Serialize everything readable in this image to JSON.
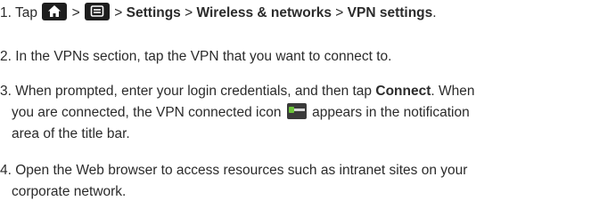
{
  "steps": [
    {
      "number": "1.",
      "prefix": "Tap",
      "sep1": ">",
      "sep2": ">",
      "settings": "Settings",
      "sep3": ">",
      "wireless": "Wireless & networks",
      "sep4": ">",
      "vpn_settings": "VPN settings",
      "end": ".",
      "icons": [
        "home-icon",
        "menu-icon"
      ]
    },
    {
      "number": "2.",
      "text": "In the VPNs section, tap the VPN that you want to connect to."
    },
    {
      "number": "3.",
      "line1_start": "When prompted, enter your login credentials, and then tap",
      "connect": "Connect",
      "line1_end": ". When",
      "line2_start": "you are connected, the VPN connected icon",
      "line2_end": "appears in the notification",
      "line3": "area of the title bar.",
      "icon": "vpn-connected-icon"
    },
    {
      "number": "4.",
      "line1": "Open the Web browser to access resources such as intranet sites on your",
      "line2": "corporate network."
    }
  ],
  "colors": {
    "text": "#2b2b2b",
    "icon_bg": "#1e1e1e",
    "vpn_key": "#6cc23a"
  }
}
